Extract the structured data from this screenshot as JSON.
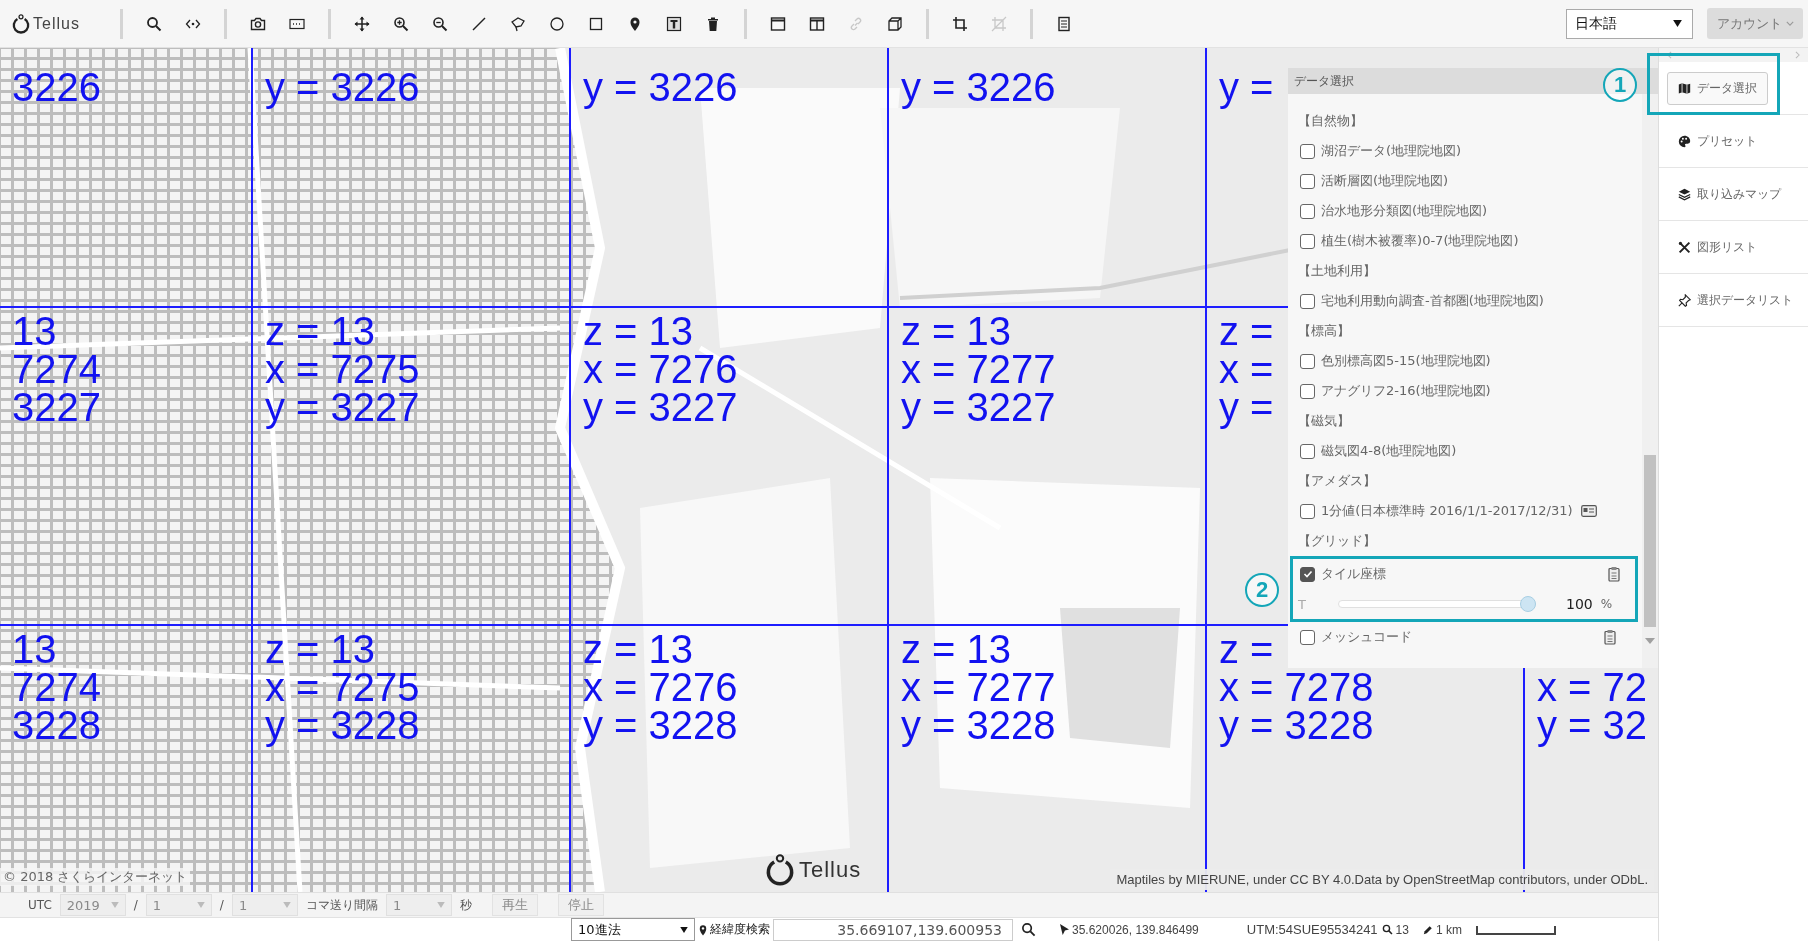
{
  "toolbar": {
    "logo": "Tellus",
    "tool_groups": [
      {
        "tools": [
          {
            "disabled": false
          },
          {
            "disabled": false
          }
        ]
      },
      {
        "tools": [
          {
            "disabled": false
          },
          {
            "disabled": false
          }
        ]
      },
      {
        "tools": [
          {
            "disabled": false
          },
          {
            "disabled": false
          },
          {
            "disabled": false
          },
          {
            "disabled": false
          },
          {
            "disabled": false
          },
          {
            "disabled": false
          },
          {
            "disabled": false
          },
          {
            "disabled": false
          },
          {
            "disabled": false
          },
          {
            "disabled": false
          }
        ]
      },
      {
        "tools": [
          {
            "disabled": false
          },
          {
            "disabled": false
          },
          {
            "disabled": true
          },
          {
            "disabled": false
          }
        ]
      },
      {
        "tools": [
          {
            "disabled": false
          },
          {
            "disabled": true
          }
        ]
      },
      {
        "tools": [
          {
            "disabled": false
          }
        ]
      }
    ],
    "language": {
      "value": "日本語"
    },
    "account": {
      "label": "アカウント"
    }
  },
  "map": {
    "tile_rows": [
      {
        "tiles": [
          {
            "lines": [
              {
                "kind": "y",
                "text": "3226"
              }
            ]
          },
          {
            "lines": [
              {
                "kind": "y",
                "text": "y = 3226"
              }
            ]
          },
          {
            "lines": [
              {
                "kind": "y",
                "text": "y = 3226"
              }
            ]
          },
          {
            "lines": [
              {
                "kind": "y",
                "text": "y = 3226"
              }
            ]
          },
          {
            "lines": [
              {
                "kind": "y",
                "text": "y ="
              }
            ]
          }
        ]
      },
      {
        "tiles": [
          {
            "lines": [
              {
                "kind": "z",
                "text": "13"
              },
              {
                "kind": "x",
                "text": "7274"
              },
              {
                "kind": "y",
                "text": "3227"
              }
            ]
          },
          {
            "lines": [
              {
                "kind": "z",
                "text": "z = 13"
              },
              {
                "kind": "x",
                "text": "x = 7275"
              },
              {
                "kind": "y",
                "text": "y = 3227"
              }
            ]
          },
          {
            "lines": [
              {
                "kind": "z",
                "text": "z = 13"
              },
              {
                "kind": "x",
                "text": "x = 7276"
              },
              {
                "kind": "y",
                "text": "y = 3227"
              }
            ]
          },
          {
            "lines": [
              {
                "kind": "z",
                "text": "z = 13"
              },
              {
                "kind": "x",
                "text": "x = 7277"
              },
              {
                "kind": "y",
                "text": "y = 3227"
              }
            ]
          },
          {
            "lines": [
              {
                "kind": "z",
                "text": "z ="
              },
              {
                "kind": "x",
                "text": "x ="
              },
              {
                "kind": "y",
                "text": "y ="
              }
            ]
          }
        ]
      },
      {
        "tiles": [
          {
            "lines": [
              {
                "kind": "z",
                "text": "13"
              },
              {
                "kind": "x",
                "text": "7274"
              },
              {
                "kind": "y",
                "text": "3228"
              }
            ]
          },
          {
            "lines": [
              {
                "kind": "z",
                "text": "z = 13"
              },
              {
                "kind": "x",
                "text": "x = 7275"
              },
              {
                "kind": "y",
                "text": "y = 3228"
              }
            ]
          },
          {
            "lines": [
              {
                "kind": "z",
                "text": "z = 13"
              },
              {
                "kind": "x",
                "text": "x = 7276"
              },
              {
                "kind": "y",
                "text": "y = 3228"
              }
            ]
          },
          {
            "lines": [
              {
                "kind": "z",
                "text": "z = 13"
              },
              {
                "kind": "x",
                "text": "x = 7277"
              },
              {
                "kind": "y",
                "text": "y = 3228"
              }
            ]
          },
          {
            "lines": [
              {
                "kind": "z",
                "text": "z ="
              },
              {
                "kind": "x",
                "text": "x = 7278"
              },
              {
                "kind": "y",
                "text": "y = 3228"
              }
            ]
          },
          {
            "lines": [
              {
                "kind": "x",
                "text": "x = 72"
              },
              {
                "kind": "y",
                "text": "y = 32"
              }
            ]
          }
        ]
      }
    ],
    "copyright": "© 2018 さくらインターネット",
    "logo": "Tellus",
    "attribution": "Maptiles by MIERUNE, under CC BY 4.0.Data by OpenStreetMap contributors, under ODbL."
  },
  "data_panel": {
    "title": "データ選択",
    "items": [
      {
        "kind": "category",
        "label": "【自然物】"
      },
      {
        "kind": "layer",
        "label": "湖沼データ(地理院地図)",
        "checked": false
      },
      {
        "kind": "layer",
        "label": "活断層図(地理院地図)",
        "checked": false
      },
      {
        "kind": "layer",
        "label": "治水地形分類図(地理院地図)",
        "checked": false
      },
      {
        "kind": "layer",
        "label": "植生(樹木被覆率)0-7(地理院地図)",
        "checked": false
      },
      {
        "kind": "category",
        "label": "【土地利用】"
      },
      {
        "kind": "layer",
        "label": "宅地利用動向調査-首都圏(地理院地図)",
        "checked": false
      },
      {
        "kind": "category",
        "label": "【標高】"
      },
      {
        "kind": "layer",
        "label": "色別標高図5-15(地理院地図)",
        "checked": false
      },
      {
        "kind": "layer",
        "label": "アナグリフ2-16(地理院地図)",
        "checked": false
      },
      {
        "kind": "category",
        "label": "【磁気】"
      },
      {
        "kind": "layer",
        "label": "磁気図4-8(地理院地図)",
        "checked": false
      },
      {
        "kind": "category",
        "label": "【アメダス】"
      },
      {
        "kind": "layer_info",
        "label": "1分値(日本標準時 2016/1/1-2017/12/31)",
        "checked": false
      },
      {
        "kind": "category",
        "label": "【グリッド】"
      },
      {
        "kind": "layer_copy",
        "label": "タイル座標",
        "checked": true,
        "callout": "2",
        "opacity": {
          "label": "T",
          "level": 1,
          "value": "100",
          "unit": "%"
        }
      },
      {
        "kind": "layer_copy",
        "label": "メッシュコード",
        "checked": false
      }
    ]
  },
  "sidebar": {
    "items": [
      {
        "label": "データ選択",
        "selected": true,
        "callout": "1"
      },
      {
        "label": "プリセット",
        "selected": false
      },
      {
        "label": "取り込みマップ",
        "selected": false
      },
      {
        "label": "図形リスト",
        "selected": false
      },
      {
        "label": "選択データリスト",
        "selected": false
      }
    ]
  },
  "time_bar": {
    "items": [
      {
        "kind": "label",
        "text": "UTC"
      },
      {
        "kind": "select",
        "value": "2019",
        "disabled": true
      },
      {
        "kind": "label",
        "text": "/"
      },
      {
        "kind": "select",
        "value": "1",
        "disabled": true
      },
      {
        "kind": "label",
        "text": "/"
      },
      {
        "kind": "select",
        "value": "1",
        "disabled": true
      },
      {
        "kind": "label",
        "text": "コマ送り間隔"
      },
      {
        "kind": "select",
        "value": "1",
        "disabled": true
      },
      {
        "kind": "label",
        "text": "秒"
      },
      {
        "kind": "button",
        "label": "再生",
        "disabled": true
      },
      {
        "kind": "button",
        "label": "停止",
        "disabled": true
      }
    ]
  },
  "status_bar": {
    "format": {
      "value": "10進法"
    },
    "search_label": "経緯度検索",
    "search": {
      "value": "35.669107,139.600953"
    },
    "cursor": "35.620026, 139.846499",
    "utm": "UTM:54SUE95534241",
    "zoom": "13",
    "scale": "1 km"
  }
}
